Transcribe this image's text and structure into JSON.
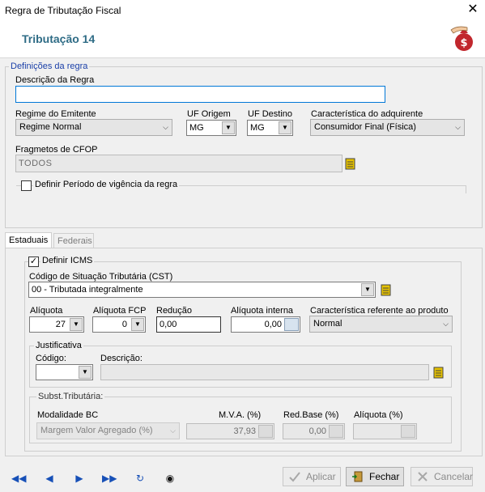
{
  "window": {
    "title": "Regra de Tributação Fiscal",
    "close_glyph": "✕"
  },
  "header": {
    "title": "Tributação 14",
    "icon": "money-bag-hand-icon"
  },
  "rule_defs": {
    "legend": "Definições da regra",
    "descricao_label": "Descrição da Regra",
    "descricao_value": "",
    "regime_label": "Regime do Emitente",
    "regime_value": "Regime Normal",
    "uf_origem_label": "UF Origem",
    "uf_origem_value": "MG",
    "uf_destino_label": "UF Destino",
    "uf_destino_value": "MG",
    "caracteristica_label": "Característica do adquirente",
    "caracteristica_value": "Consumidor Final (Física)",
    "cfop_label": "Fragmetos de CFOP",
    "cfop_value": "TODOS",
    "vigencia_label": "Definir Período de vigência da regra",
    "vigencia_checked": false
  },
  "tabs": [
    {
      "label": "Estaduais",
      "active": true
    },
    {
      "label": "Federais",
      "active": false
    }
  ],
  "icms": {
    "define_label": "Definir ICMS",
    "define_checked": true,
    "cst_label": "Código de Situação Tributária (CST)",
    "cst_value": "00 - Tributada integralmente",
    "aliquota_label": "Alíquota",
    "aliquota_value": "27",
    "aliquota_fcp_label": "Alíquota FCP",
    "aliquota_fcp_value": "0",
    "reducao_label": "Redução",
    "reducao_value": "0,00",
    "aliquota_interna_label": "Alíquota interna",
    "aliquota_interna_value": "0,00",
    "caracteristica_produto_label": "Característica referente ao produto",
    "caracteristica_produto_value": "Normal"
  },
  "justificativa": {
    "legend": "Justificativa",
    "codigo_label": "Código:",
    "codigo_value": "",
    "descricao_label": "Descrição:",
    "descricao_value": ""
  },
  "subst": {
    "legend": "Subst.Tributária:",
    "modalidade_label": "Modalidade BC",
    "modalidade_value": "Margem Valor Agregado (%)",
    "mva_label": "M.V.A. (%)",
    "mva_value": "37,93",
    "red_base_label": "Red.Base (%)",
    "red_base_value": "0,00",
    "aliquota_label": "Alíquota (%)",
    "aliquota_value": ""
  },
  "footer": {
    "nav": [
      "◀◀",
      "◀",
      "▶",
      "▶▶",
      "↻",
      "◉"
    ],
    "aplicar": "Aplicar",
    "fechar": "Fechar",
    "cancelar": "Cancelar"
  },
  "colors": {
    "header_title": "#2f6c86",
    "nav_blue": "#1750b7",
    "focus_border": "#0078d7"
  }
}
